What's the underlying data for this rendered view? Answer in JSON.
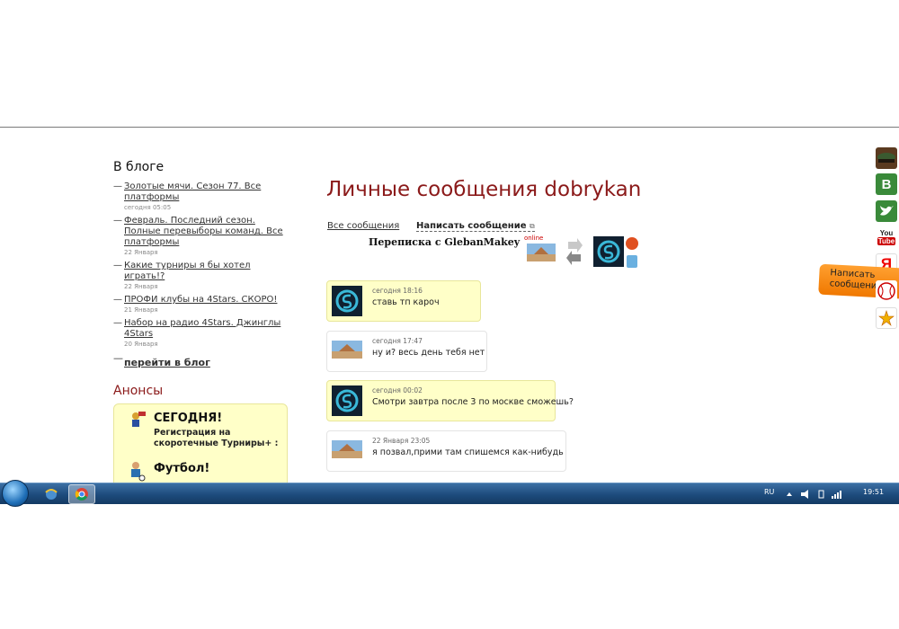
{
  "blog": {
    "title": "В блоге",
    "items": [
      {
        "title": "Золотые мячи. Сезон 77. Все платформы",
        "date": "сегодня 05:05"
      },
      {
        "title": "Февраль. Последний сезон. Полные перевыборы команд. Все платформы",
        "date": "22 Января"
      },
      {
        "title": "Какие турниры я бы хотел играть!?",
        "date": "22 Января"
      },
      {
        "title": "ПРОФИ клубы на 4Stars. СКОРО!",
        "date": "21 Января"
      },
      {
        "title": "Набор на радио 4Stars. Джинглы 4Stars",
        "date": "20 Января"
      }
    ],
    "more": "перейти в блог"
  },
  "anons": {
    "title": "Анонсы",
    "items": [
      {
        "title": "СЕГОДНЯ!",
        "text": "Регистрация на скоротечные Турниры+ :"
      },
      {
        "title": "Футбол!",
        "text": ""
      }
    ]
  },
  "main": {
    "title": "Личные сообщения dobrykan",
    "tab_all": "Все сообщения",
    "tab_write": "Написать сообщение",
    "conversation_title": "Переписка с GlebanMakey",
    "online_label": "online"
  },
  "messages": [
    {
      "time": "сегодня 18:16",
      "text": "ставь тп кароч",
      "mine": true
    },
    {
      "time": "сегодня 17:47",
      "text": "ну и? весь день тебя нет",
      "mine": false
    },
    {
      "time": "сегодня 00:02",
      "text": "Смотри завтра после 3 по москве сможешь?",
      "mine": true
    },
    {
      "time": "22 Января 23:05",
      "text": "я позвал,прими там спишемся как-нибудь",
      "mine": false
    }
  ],
  "social": {
    "vk": "В",
    "yandex": "Я",
    "youtube_top": "You",
    "youtube_bottom": "Tube",
    "write_tab": "Написать сообщение"
  },
  "taskbar": {
    "lang": "RU",
    "clock": "19:51"
  },
  "colors": {
    "title_red": "#8b1a1a",
    "bubble_yellow": "#ffffc8",
    "taskbar_blue": "#1d4b7c"
  }
}
